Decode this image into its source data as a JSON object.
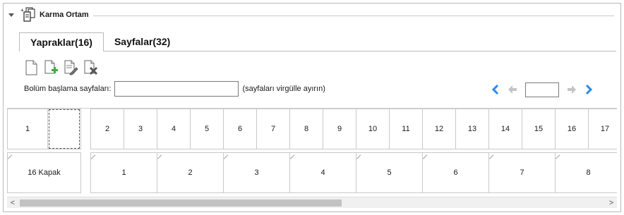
{
  "section": {
    "title": "Karma Ortam"
  },
  "tabs": [
    {
      "label": "Yapraklar(16)",
      "active": true
    },
    {
      "label": "Sayfalar(32)",
      "active": false
    }
  ],
  "toolbar": {
    "icons": [
      "new-page-icon",
      "add-page-icon",
      "edit-page-icon",
      "delete-page-icon"
    ]
  },
  "start_pages": {
    "label": "Bolüm başlama sayfaları:",
    "value": "",
    "hint": "(sayfaları virgülle ayırın)"
  },
  "pager": {
    "value": ""
  },
  "sheets_row": [
    "1",
    "",
    "2",
    "3",
    "4",
    "5",
    "6",
    "7",
    "8",
    "9",
    "10",
    "11",
    "12",
    "13",
    "14",
    "15",
    "16",
    "17"
  ],
  "pages_row": [
    "16 Kapak",
    "1",
    "2",
    "3",
    "4",
    "5",
    "6",
    "7",
    "8"
  ],
  "colors": {
    "accent_blue": "#2c8be6",
    "disabled_gray": "#b8b8b8"
  },
  "scrollbar": {
    "left_arrow": "<",
    "right_arrow": ">"
  }
}
